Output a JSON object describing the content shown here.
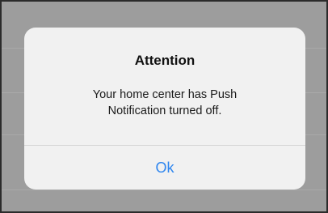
{
  "alert": {
    "title": "Attention",
    "message_line_1": "Your home center has Push",
    "message_line_2": "Notification turned off.",
    "ok_label": "Ok"
  },
  "colors": {
    "overlay_background": "#9d9d9d",
    "dialog_background": "#f1f1f1",
    "button_text": "#2f86ef",
    "divider": "#d7d7d7"
  }
}
